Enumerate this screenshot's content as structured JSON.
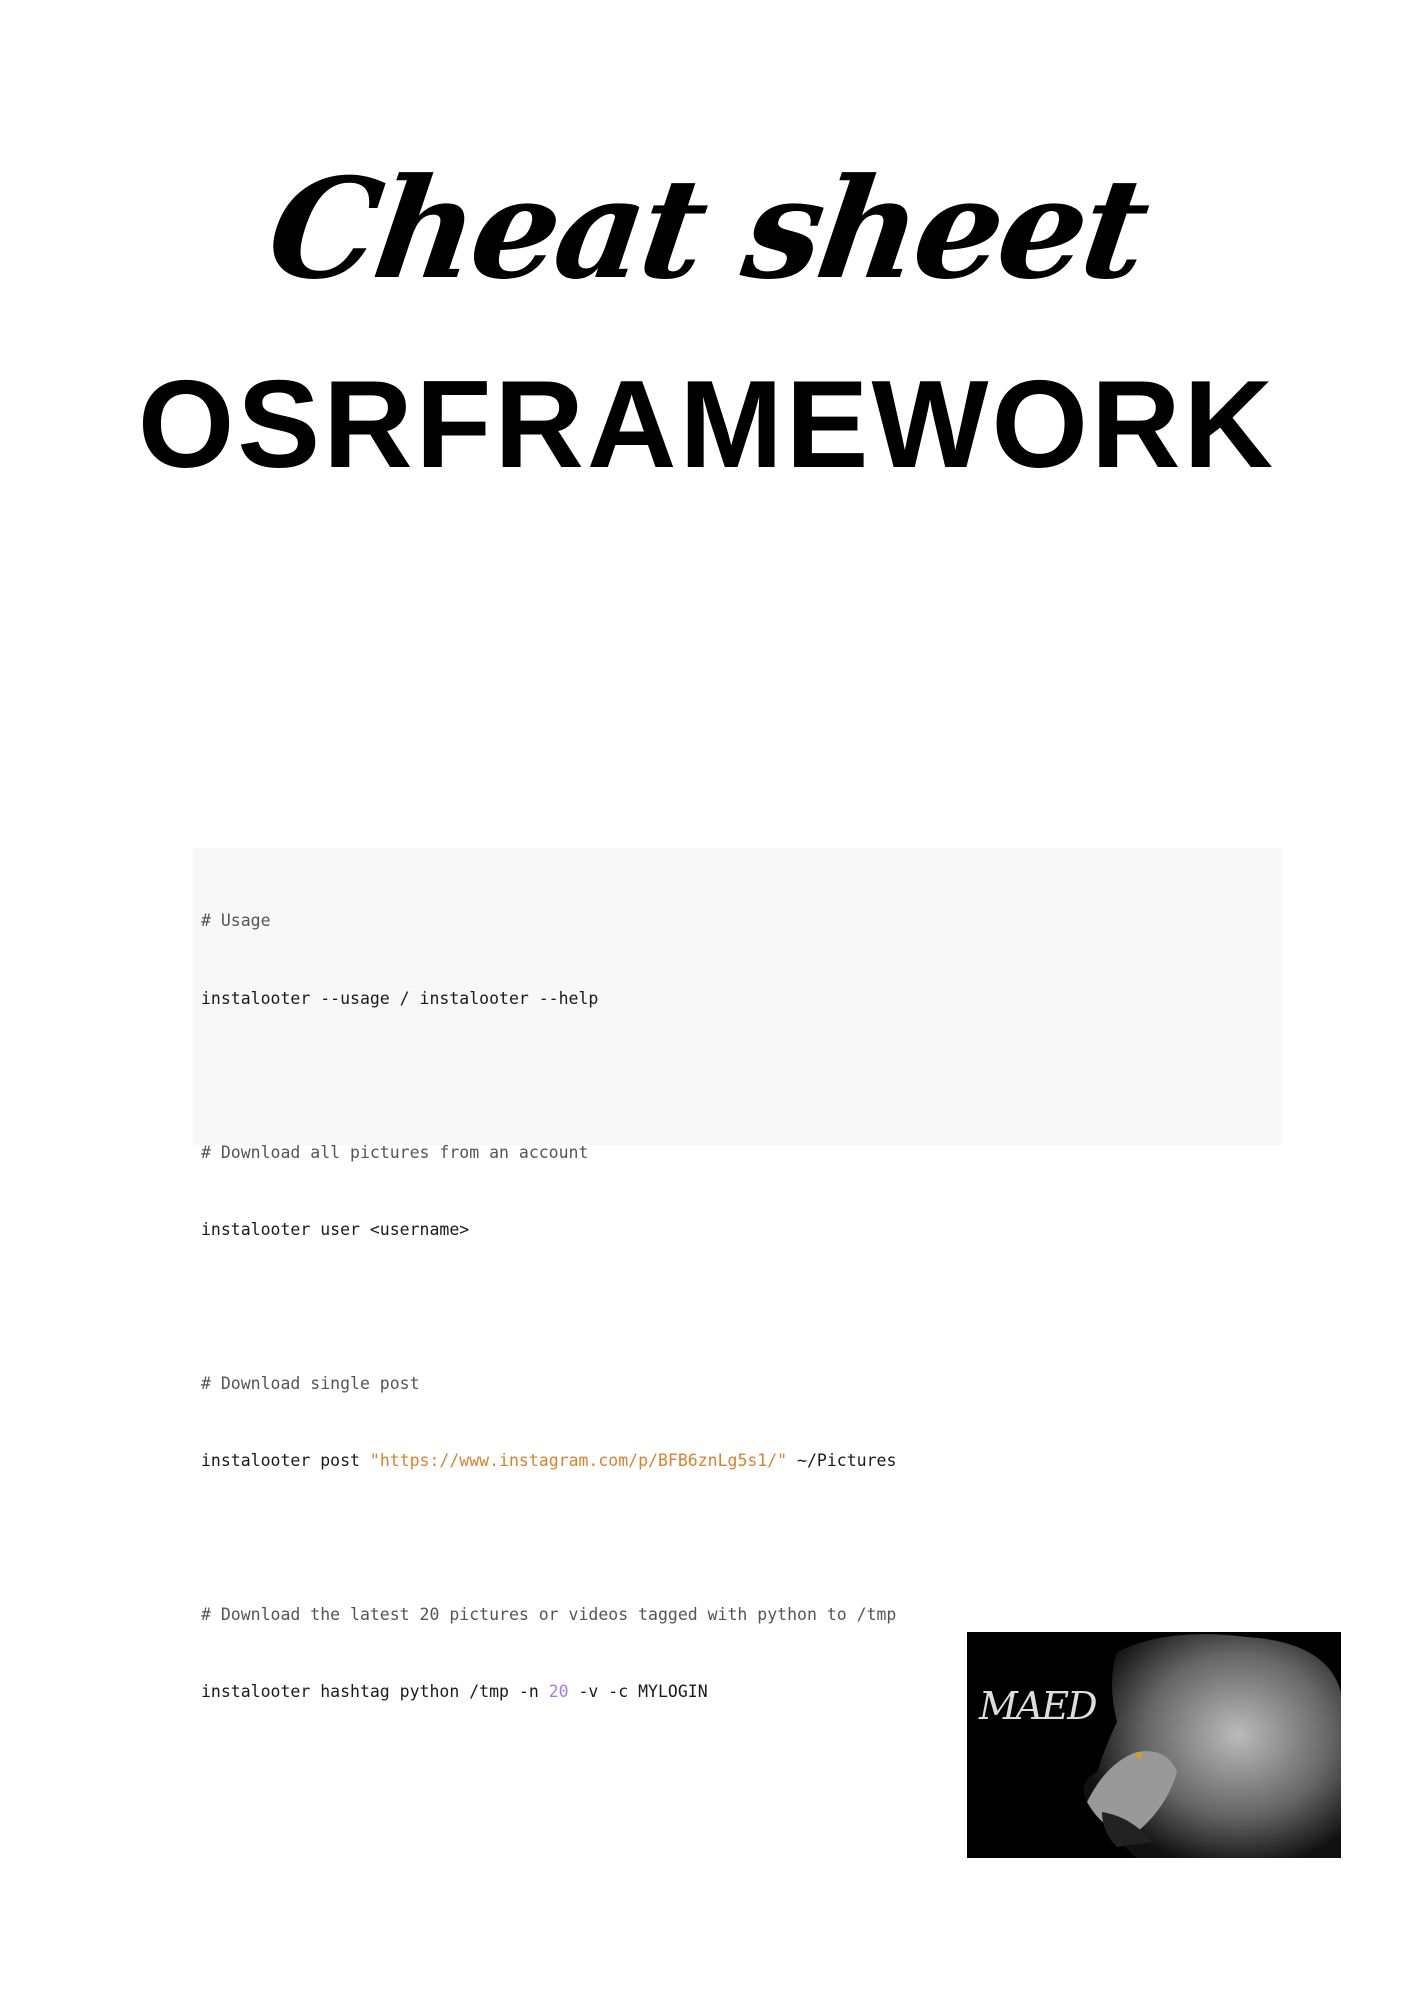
{
  "header": {
    "script_title": "Cheat sheet",
    "title": "OSRFRAMEWORK"
  },
  "code": {
    "lines": [
      {
        "comment": "# Usage"
      },
      {
        "cmd": "instalooter --usage / instalooter --help"
      },
      {
        "comment": "# Download all pictures from an account"
      },
      {
        "cmd": "instalooter user <username>"
      },
      {
        "comment": "# Download single post"
      },
      {
        "cmd_prefix": "instalooter post ",
        "string": "\"https://www.instagram.com/p/BFB6znLg5s1/\"",
        "cmd_suffix": " ~/Pictures"
      },
      {
        "comment": "# Download the latest 20 pictures or videos tagged with python to /tmp"
      },
      {
        "cmd_prefix": "instalooter hashtag python /tmp -n ",
        "number": "20",
        "cmd_suffix": " -v -c MYLOGIN"
      }
    ]
  },
  "logo": {
    "text": "MAED"
  },
  "colors": {
    "string": "#d9822b",
    "number": "#a77bef",
    "code_bg": "#f8f8f8"
  }
}
